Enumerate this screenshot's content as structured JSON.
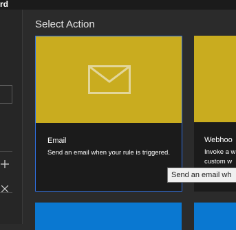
{
  "window": {
    "title": "rd"
  },
  "section": {
    "title": "Select Action"
  },
  "actions": [
    {
      "name": "Email",
      "description": "Send an email when your rule is triggered.",
      "banner_color": "#c9ac1f",
      "icon": "envelope-icon",
      "selected": true
    },
    {
      "name": "Webhoo",
      "description_lines": [
        "Invoke a w",
        "custom w"
      ],
      "banner_color": "#c9ac1f"
    }
  ],
  "tooltip": {
    "text": "Send an email wh"
  },
  "sidebar": {
    "icons": [
      "add-icon",
      "close-icon"
    ]
  },
  "colors": {
    "selection_border": "#2f6fe0",
    "next_row_card": "#0a78d1"
  }
}
